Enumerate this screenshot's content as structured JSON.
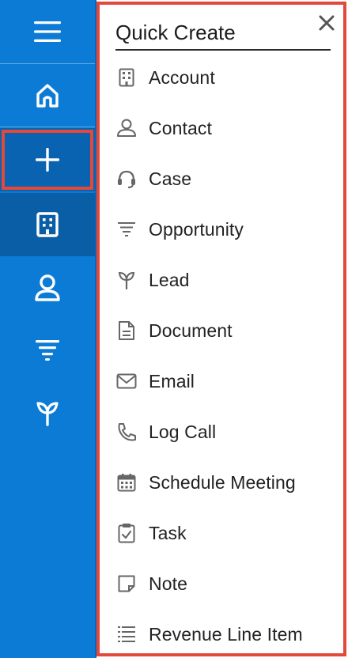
{
  "rail": {
    "items": [
      {
        "icon": "hamburger-menu-icon"
      },
      {
        "icon": "home-icon"
      },
      {
        "icon": "plus-icon"
      },
      {
        "icon": "building-icon"
      },
      {
        "icon": "person-icon"
      },
      {
        "icon": "funnel-icon"
      },
      {
        "icon": "sprout-icon"
      }
    ],
    "colors": {
      "background": "#0b7bd6",
      "active": "#0a5ea6",
      "highlight": "#e2493a"
    }
  },
  "quick_create": {
    "title": "Quick Create",
    "close_icon": "close-icon",
    "items": [
      {
        "label": "Account",
        "icon": "building-icon"
      },
      {
        "label": "Contact",
        "icon": "person-icon"
      },
      {
        "label": "Case",
        "icon": "headset-icon"
      },
      {
        "label": "Opportunity",
        "icon": "funnel-icon"
      },
      {
        "label": "Lead",
        "icon": "sprout-icon"
      },
      {
        "label": "Document",
        "icon": "document-icon"
      },
      {
        "label": "Email",
        "icon": "envelope-icon"
      },
      {
        "label": "Log Call",
        "icon": "phone-icon"
      },
      {
        "label": "Schedule Meeting",
        "icon": "calendar-icon"
      },
      {
        "label": "Task",
        "icon": "task-check-icon"
      },
      {
        "label": "Note",
        "icon": "note-icon"
      },
      {
        "label": "Revenue Line Item",
        "icon": "list-icon"
      }
    ]
  }
}
